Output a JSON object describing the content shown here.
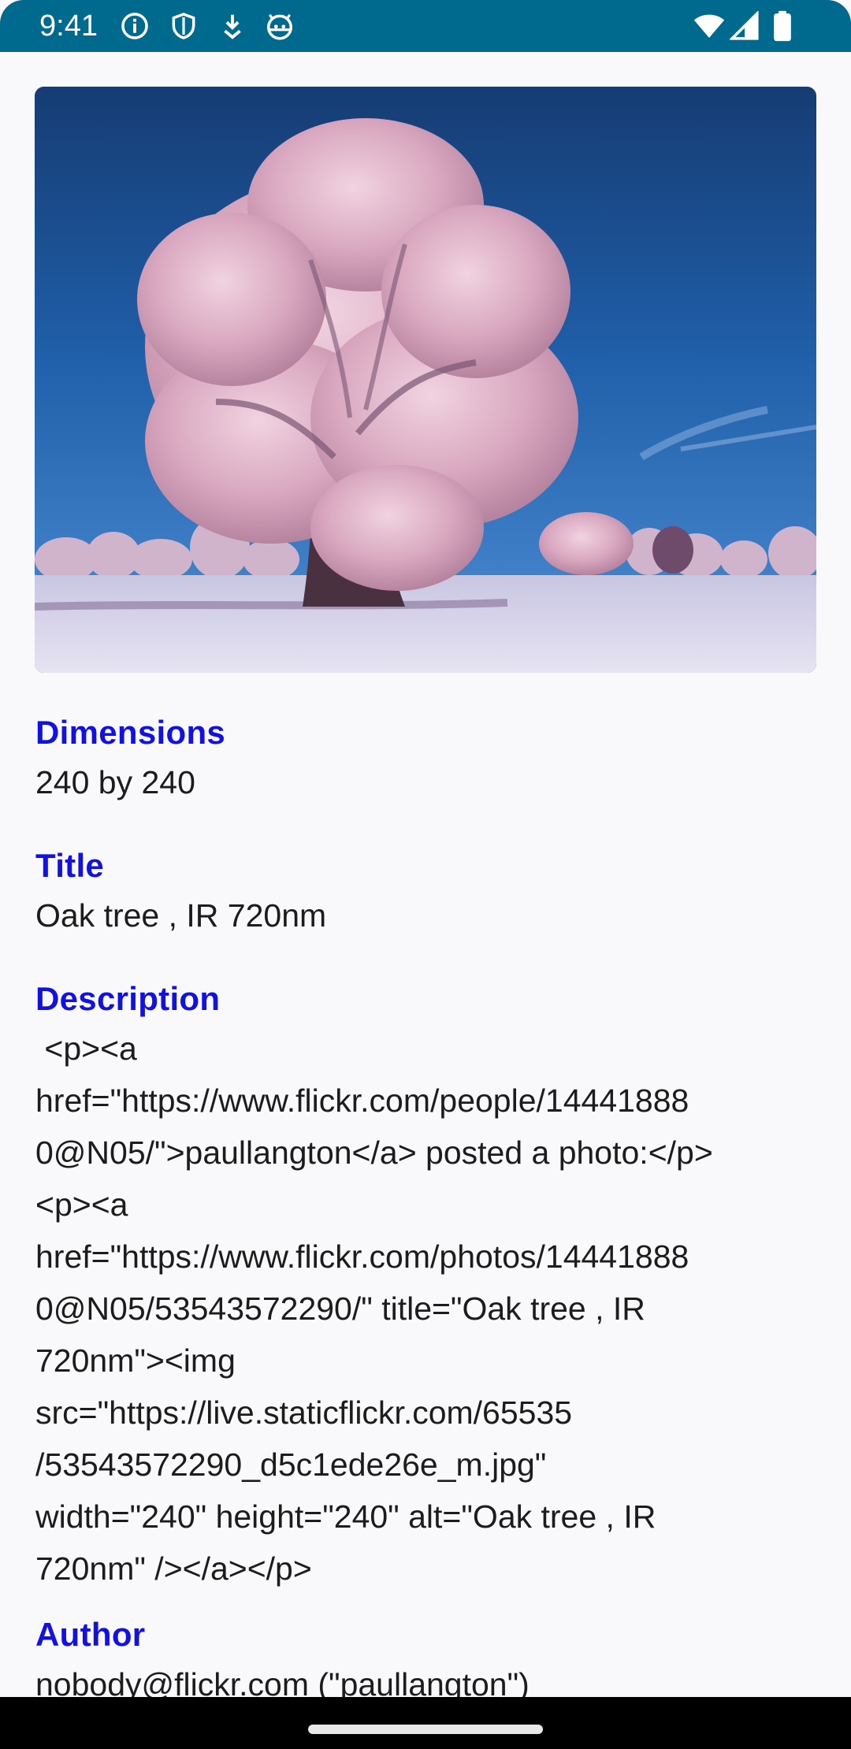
{
  "status_bar": {
    "time": "9:41",
    "background": "#006a8e",
    "left_icons": [
      "info-icon",
      "shield-icon",
      "download-icon",
      "android-face-icon"
    ],
    "right_icons": [
      "wifi-icon",
      "cellular-signal-icon",
      "battery-icon"
    ]
  },
  "photo": {
    "subject": "oak-tree-infrared-photo"
  },
  "fields": {
    "dimensions": {
      "label": "Dimensions",
      "value": "240 by 240"
    },
    "title": {
      "label": "Title",
      "value": "Oak tree , IR 720nm"
    },
    "description": {
      "label": "Description",
      "lines": [
        " <p><a",
        "href=\"https://www.flickr.com/people/14441888",
        "0@N05/\">paullangton</a> posted a photo:</p>",
        "<p><a",
        "href=\"https://www.flickr.com/photos/14441888",
        "0@N05/53543572290/\" title=\"Oak tree , IR",
        "720nm\"><img",
        "src=\"https://live.staticflickr.com/65535",
        "/53543572290_d5c1ede26e_m.jpg\"",
        "width=\"240\" height=\"240\" alt=\"Oak tree , IR",
        "720nm\" /></a></p>"
      ]
    },
    "author": {
      "label": "Author",
      "value": "nobody@flickr.com (\"paullangton\")"
    }
  },
  "colors": {
    "label": "#1111e6",
    "text": "#1c1c1c",
    "background": "#f9f9fb",
    "nav_bar": "#000000"
  }
}
